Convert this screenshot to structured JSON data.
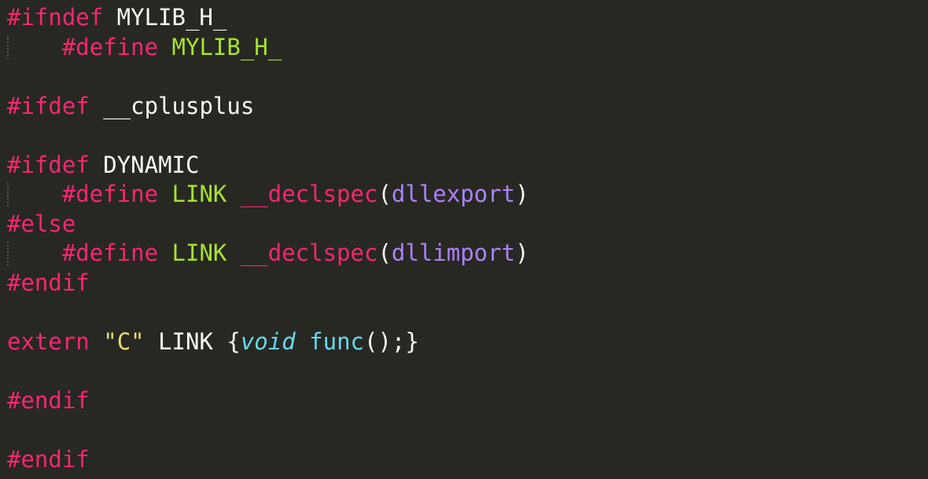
{
  "editor": {
    "background": "#272822",
    "language": "C",
    "theme_colors": {
      "keyword": "#f92672",
      "plain": "#f8f8f2",
      "macro": "#a6e22e",
      "argument": "#ae81ff",
      "string": "#e6db74",
      "type": "#66d9ef",
      "function": "#66d9ef"
    },
    "lines": [
      [
        {
          "t": "#ifndef",
          "k": "keyword"
        },
        {
          "t": " MYLIB_H_",
          "k": "plain"
        }
      ],
      [
        {
          "t": "    ",
          "k": "plain"
        },
        {
          "t": "#define",
          "k": "keyword"
        },
        {
          "t": " ",
          "k": "plain"
        },
        {
          "t": "MYLIB_H_",
          "k": "macro"
        }
      ],
      [],
      [
        {
          "t": "#ifdef",
          "k": "keyword"
        },
        {
          "t": " __cplusplus",
          "k": "plain"
        }
      ],
      [],
      [
        {
          "t": "#ifdef",
          "k": "keyword"
        },
        {
          "t": " DYNAMIC",
          "k": "plain"
        }
      ],
      [
        {
          "t": "    ",
          "k": "plain"
        },
        {
          "t": "#define",
          "k": "keyword"
        },
        {
          "t": " ",
          "k": "plain"
        },
        {
          "t": "LINK",
          "k": "macro"
        },
        {
          "t": " ",
          "k": "plain"
        },
        {
          "t": "__declspec",
          "k": "keyword"
        },
        {
          "t": "(",
          "k": "plain"
        },
        {
          "t": "dllexport",
          "k": "argument"
        },
        {
          "t": ")",
          "k": "plain"
        }
      ],
      [
        {
          "t": "#else",
          "k": "keyword"
        }
      ],
      [
        {
          "t": "    ",
          "k": "plain"
        },
        {
          "t": "#define",
          "k": "keyword"
        },
        {
          "t": " ",
          "k": "plain"
        },
        {
          "t": "LINK",
          "k": "macro"
        },
        {
          "t": " ",
          "k": "plain"
        },
        {
          "t": "__declspec",
          "k": "keyword"
        },
        {
          "t": "(",
          "k": "plain"
        },
        {
          "t": "dllimport",
          "k": "argument"
        },
        {
          "t": ")",
          "k": "plain"
        }
      ],
      [
        {
          "t": "#endif",
          "k": "keyword"
        }
      ],
      [],
      [
        {
          "t": "extern",
          "k": "keyword"
        },
        {
          "t": " ",
          "k": "plain"
        },
        {
          "t": "\"C\"",
          "k": "string"
        },
        {
          "t": " LINK {",
          "k": "plain"
        },
        {
          "t": "void",
          "k": "type"
        },
        {
          "t": " ",
          "k": "plain"
        },
        {
          "t": "func",
          "k": "function"
        },
        {
          "t": "();}",
          "k": "plain"
        }
      ],
      [],
      [
        {
          "t": "#endif",
          "k": "keyword"
        }
      ],
      [],
      [
        {
          "t": "#endif",
          "k": "keyword"
        }
      ]
    ],
    "indented_lines": [
      1,
      6,
      8
    ]
  }
}
